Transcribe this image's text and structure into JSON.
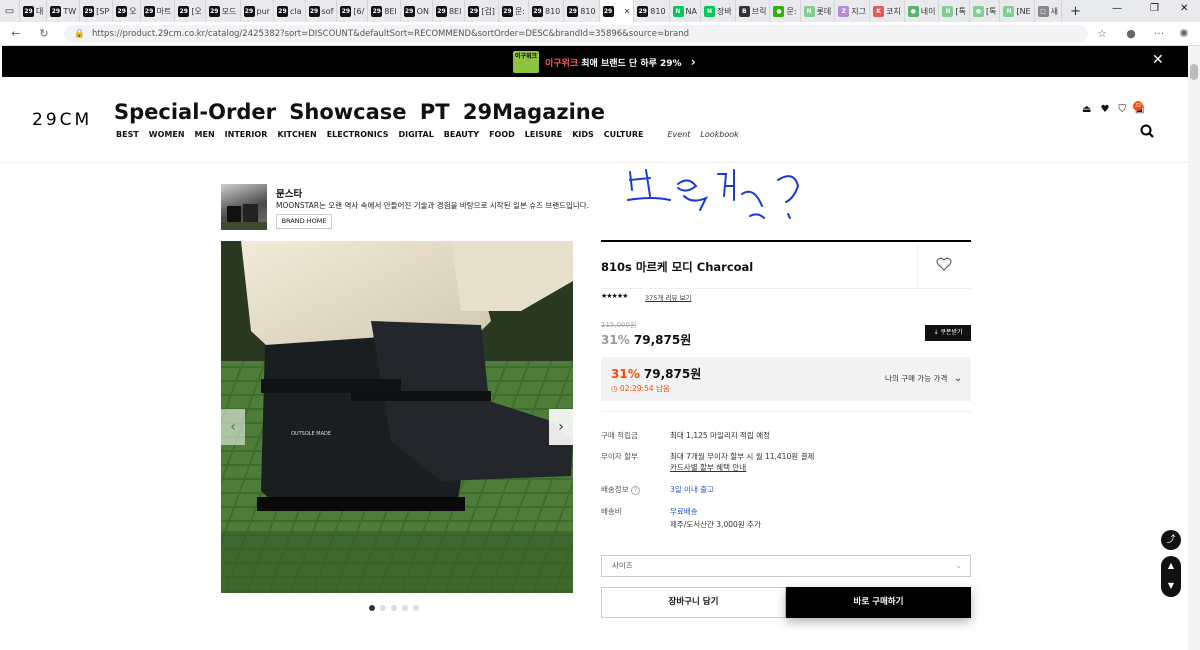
{
  "browser": {
    "tabs": [
      {
        "icon": "29",
        "color": "#111",
        "label": "대"
      },
      {
        "icon": "29",
        "color": "#111",
        "label": "TW"
      },
      {
        "icon": "29",
        "color": "#111",
        "label": "[SP"
      },
      {
        "icon": "29",
        "color": "#111",
        "label": "오"
      },
      {
        "icon": "29",
        "color": "#111",
        "label": "마트"
      },
      {
        "icon": "29",
        "color": "#111",
        "label": "[오"
      },
      {
        "icon": "29",
        "color": "#111",
        "label": "모드"
      },
      {
        "icon": "29",
        "color": "#111",
        "label": "pur"
      },
      {
        "icon": "29",
        "color": "#111",
        "label": "cla"
      },
      {
        "icon": "29",
        "color": "#111",
        "label": "sof"
      },
      {
        "icon": "29",
        "color": "#111",
        "label": "[6/"
      },
      {
        "icon": "29",
        "color": "#111",
        "label": "8El"
      },
      {
        "icon": "29",
        "color": "#111",
        "label": "ON"
      },
      {
        "icon": "29",
        "color": "#111",
        "label": "8El"
      },
      {
        "icon": "29",
        "color": "#111",
        "label": "[겁]"
      },
      {
        "icon": "29",
        "color": "#111",
        "label": "문:"
      },
      {
        "icon": "29",
        "color": "#111",
        "label": "810"
      },
      {
        "icon": "29",
        "color": "#111",
        "label": "810"
      },
      {
        "icon": "29",
        "color": "#111",
        "label": ""
      },
      {
        "icon": "29",
        "color": "#111",
        "label": "810"
      },
      {
        "icon": "N",
        "color": "#03c75a",
        "label": "NA"
      },
      {
        "icon": "N",
        "color": "#03c75a",
        "label": "장바"
      },
      {
        "icon": "B",
        "color": "#333",
        "label": "브릭"
      },
      {
        "icon": "●",
        "color": "#2db400",
        "label": "문:"
      },
      {
        "icon": "N",
        "color": "#7fcf90",
        "label": "롯데"
      },
      {
        "icon": "Z",
        "color": "#b58ad6",
        "label": "지그"
      },
      {
        "icon": "K",
        "color": "#e25a5a",
        "label": "코치"
      },
      {
        "icon": "●",
        "color": "#55b56a",
        "label": "네이"
      },
      {
        "icon": "N",
        "color": "#7fcf90",
        "label": "[톡"
      },
      {
        "icon": "●",
        "color": "#7fcf90",
        "label": "[톡"
      },
      {
        "icon": "N",
        "color": "#7fcf90",
        "label": "[NE"
      },
      {
        "icon": "□",
        "color": "#888",
        "label": "새"
      }
    ],
    "url": "https://product.29cm.co.kr/catalog/2425382?sort=DISCOUNT&defaultSort=RECOMMEND&sortOrder=DESC&brandId=35896&source=brand"
  },
  "promo": {
    "badge": "이구위크",
    "highlight": "이구위크",
    "text": " 최애 브랜드 단 하루 29%",
    "arrow": "›",
    "close": "✕"
  },
  "header": {
    "logo": "29CM",
    "showcase": "Special-Order Showcase PT 29Magazine",
    "nav": [
      "BEST",
      "WOMEN",
      "MEN",
      "INTERIOR",
      "KITCHEN",
      "ELECTRONICS",
      "DIGITAL",
      "BEAUTY",
      "FOOD",
      "LEISURE",
      "KIDS",
      "CULTURE"
    ],
    "nav_extra": [
      "Event",
      "Lookbook"
    ],
    "cart_count": "32"
  },
  "brand": {
    "name": "문스타",
    "description": "MOONSTAR는 오랜 역사 속에서 만들어진 기술과 경험을 바탕으로 시작된 일본 슈즈 브랜드입니다.",
    "home_button": "BRAND HOME"
  },
  "product": {
    "title": "810s 마르케 모디 Charcoal",
    "stars": "★★★★★",
    "review_link": "375개 리뷰 보기",
    "original_price": "115,000원",
    "discount_pct": "31%",
    "price": "79,875원",
    "coupon_button": "↓ 쿠폰받기",
    "final_pct": "31%",
    "final_price": "79,875원",
    "timer": "◷ 02:29:54 남음",
    "my_price_label": "나의 구매 가능 가격",
    "boot_print": "OUTSOLE MADE"
  },
  "info": {
    "points_label": "구매 적립금",
    "points_value": "최대 1,125 마일리지 적립 예정",
    "installment_label": "무이자 할부",
    "installment_value": "최대 7개월 무이자 할부 시 월 11,410원 결제",
    "installment_link": "카드사별 할부 혜택 안내",
    "delivery_label": "배송정보",
    "delivery_value": "3일 이내 출고",
    "shipping_label": "배송비",
    "shipping_value": "무료배송",
    "shipping_note": "제주/도서산간 3,000원 추가"
  },
  "actions": {
    "size_placeholder": "사이즈",
    "cart": "장바구니 담기",
    "buy": "바로 구매하기"
  },
  "colors": {
    "accent": "#ff4800",
    "link": "#2456d8",
    "promo_bg": "#000000",
    "badge": "#8bc53f"
  }
}
